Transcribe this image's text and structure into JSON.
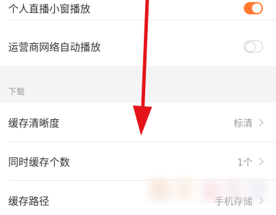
{
  "settings": {
    "pip_live": {
      "label": "个人直播小窗播放",
      "enabled": true
    },
    "carrier_autoplay": {
      "label": "运营商网络自动播放",
      "enabled": false
    },
    "download_section": {
      "title": "下载"
    },
    "cache_quality": {
      "label": "缓存清晰度",
      "value": "标清"
    },
    "concurrent_cache": {
      "label": "同时缓存个数",
      "value": "1个"
    },
    "cache_path": {
      "label": "缓存路径",
      "value": "手机存储"
    }
  },
  "colors": {
    "toggle_on": "#ff7a30",
    "arrow": "#e4141a",
    "background": "#f4f4f6"
  },
  "icons": {
    "chevron": "chevron-right-icon",
    "annotation": "red-arrow-annotation"
  }
}
